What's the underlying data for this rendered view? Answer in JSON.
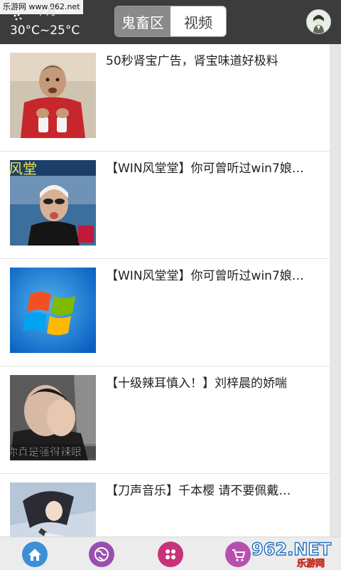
{
  "watermark": {
    "top_text": "乐游网 www.962.net",
    "bottom_text": "962.NET",
    "bottom_sub": "乐游网"
  },
  "status": {
    "fragment": "/ 月",
    "temperature": "30°C~25°C"
  },
  "header": {
    "tabs": [
      {
        "label": "鬼畜区",
        "active": true
      },
      {
        "label": "视频",
        "active": false
      }
    ]
  },
  "list": [
    {
      "title": "50秒肾宝广告，肾宝味道好极料",
      "thumb": "man-red-shirt"
    },
    {
      "title": "【WIN风堂堂】你可曾听过win7娘…",
      "thumb": "swimmer-interview",
      "caption": "风堂"
    },
    {
      "title": "【WIN风堂堂】你可曾听过win7娘…",
      "thumb": "windows-logo"
    },
    {
      "title": "【十级辣耳慎入！】刘梓晨的娇喘",
      "thumb": "man-covering-face",
      "caption": "你真是骚得辣眼"
    },
    {
      "title": "【刀声音乐】千本樱 请不要佩戴…",
      "thumb": "anime-girl"
    }
  ],
  "bottom_nav": [
    {
      "name": "home",
      "color": "#3a8fd8"
    },
    {
      "name": "globe",
      "color": "#9a4fb0"
    },
    {
      "name": "apps",
      "color": "#c8327a"
    },
    {
      "name": "cart",
      "color": "#b84fb0"
    }
  ]
}
